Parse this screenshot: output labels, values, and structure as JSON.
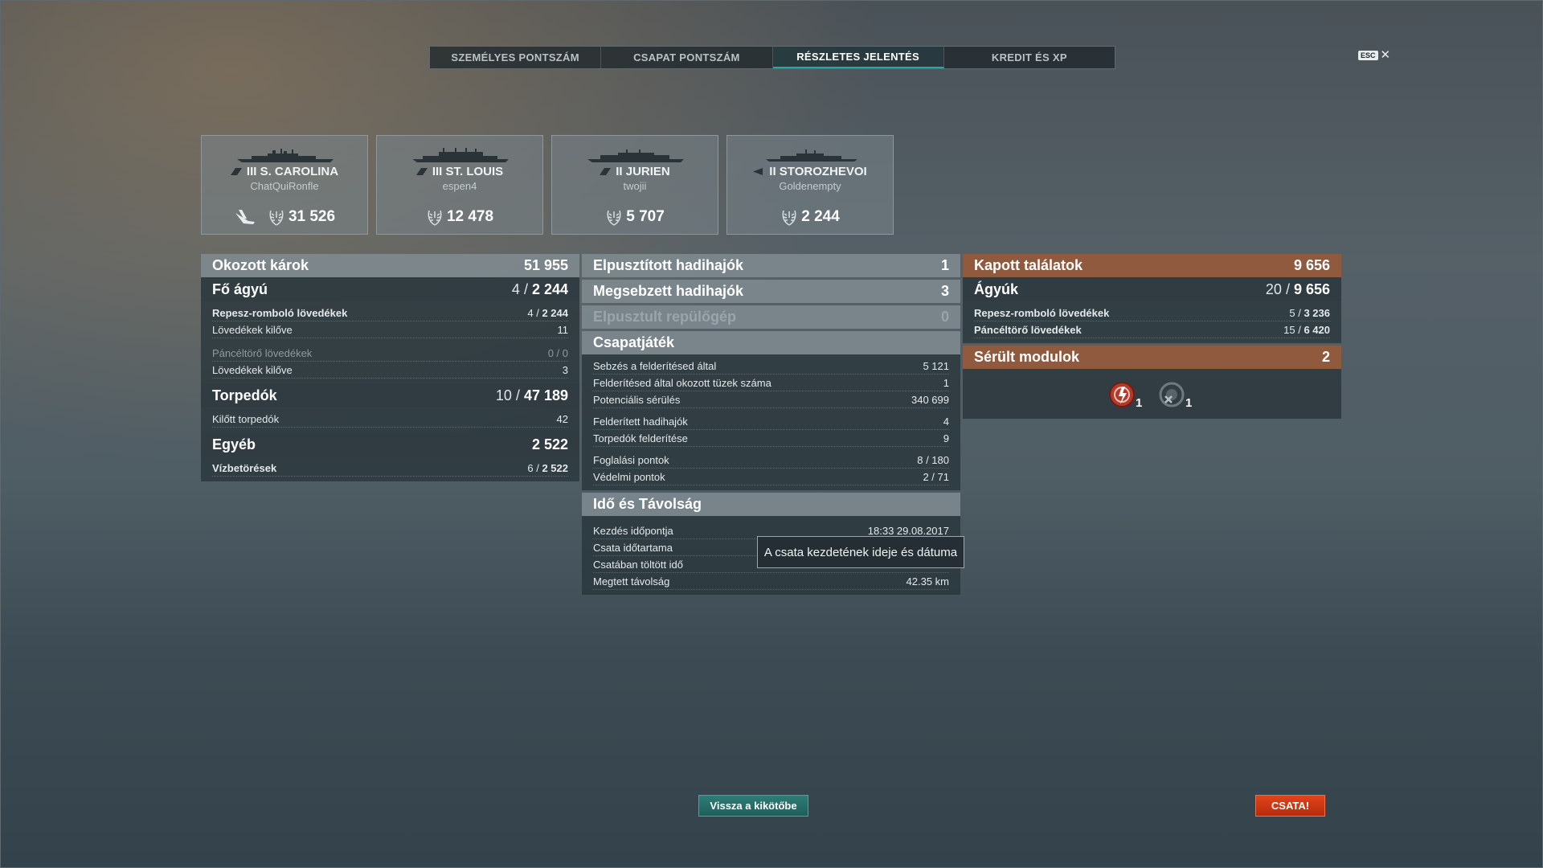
{
  "tabs": [
    {
      "label": "SZEMÉLYES PONTSZÁM"
    },
    {
      "label": "CSAPAT PONTSZÁM"
    },
    {
      "label": "RÉSZLETES JELENTÉS"
    },
    {
      "label": "KREDIT ÉS XP"
    }
  ],
  "active_tab": "RÉSZLETES JELENTÉS",
  "esc": {
    "key": "ESC",
    "close": "✕"
  },
  "ships": [
    {
      "name": "III S. CAROLINA",
      "player": "ChatQuiRonfle",
      "score": "31 526",
      "class_icon": "cruiser-icon",
      "extra_icon": "plane-icon"
    },
    {
      "name": "III ST. LOUIS",
      "player": "espen4",
      "score": "12 478",
      "class_icon": "cruiser-icon"
    },
    {
      "name": "II JURIEN",
      "player": "twojii",
      "score": "5 707",
      "class_icon": "cruiser-icon"
    },
    {
      "name": "II STOROZHEVOI",
      "player": "Goldenempty",
      "score": "2 244",
      "class_icon": "destroyer-icon"
    }
  ],
  "damage": {
    "title": "Okozott károk",
    "total": "51 955",
    "main_battery": {
      "title": "Fő ágyú",
      "hits": "4",
      "value": "2 244"
    },
    "he_shells": {
      "label": "Repesz-romboló lövedékek",
      "hits": "4",
      "value": "2 244"
    },
    "he_fired": {
      "label": "Lövedékek kilőve",
      "value": "11"
    },
    "ap_shells": {
      "label": "Páncéltörő lövedékek",
      "value": "0 / 0"
    },
    "ap_fired": {
      "label": "Lövedékek kilőve",
      "value": "3"
    },
    "torpedoes": {
      "title": "Torpedók",
      "hits": "10",
      "value": "47 189"
    },
    "torp_fired": {
      "label": "Kilőtt torpedók",
      "value": "42"
    },
    "other": {
      "title": "Egyéb",
      "value": "2 522"
    },
    "flooding": {
      "label": "Vízbetörések",
      "hits": "6",
      "value": "2 522"
    }
  },
  "ships_destroyed": {
    "label": "Elpusztított hadihajók",
    "value": "1"
  },
  "ships_damaged": {
    "label": "Megsebzett hadihajók",
    "value": "3"
  },
  "planes_destroyed": {
    "label": "Elpusztult repülőgép",
    "value": "0"
  },
  "teamplay": {
    "title": "Csapatjáték",
    "rows": [
      {
        "label": "Sebzés a felderítésed által",
        "value": "5 121"
      },
      {
        "label": "Felderítésed által okozott tüzek száma",
        "value": "1"
      },
      {
        "label": "Potenciális sérülés",
        "value": "340 699"
      },
      {
        "label": "Felderített hadihajók",
        "value": "4"
      },
      {
        "label": "Torpedók felderítése",
        "value": "9"
      },
      {
        "label": "Foglalási pontok",
        "value": "8 / 180"
      },
      {
        "label": "Védelmi pontok",
        "value": "2 / 71"
      }
    ]
  },
  "time": {
    "title": "Idő és Távolság",
    "rows": [
      {
        "label": "Kezdés időpontja",
        "value": "18:33  29.08.2017"
      },
      {
        "label": "Csata időtartama",
        "value": ""
      },
      {
        "label": "Csatában töltött idő",
        "value": ""
      },
      {
        "label": "Megtett távolság",
        "value": "42.35 km"
      }
    ]
  },
  "tooltip": "A csata kezdetének ideje és dátuma",
  "received": {
    "title": "Kapott találatok",
    "total": "9 656",
    "guns": {
      "title": "Ágyúk",
      "hits": "20",
      "value": "9 656"
    },
    "he": {
      "label": "Repesz-romboló lövedékek",
      "hits": "5",
      "value": "3 236"
    },
    "ap": {
      "label": "Páncéltörő lövedékek",
      "hits": "15",
      "value": "6 420"
    }
  },
  "modules": {
    "title": "Sérült modulok",
    "total": "2",
    "items": [
      {
        "icon": "damaged-engine-icon",
        "count": "1",
        "color": "#c0392b"
      },
      {
        "icon": "destroyed-module-icon",
        "count": "1",
        "color": "#7f8c8d"
      }
    ]
  },
  "buttons": {
    "back_to_port": "Vissza a kikötőbe",
    "battle": "CSATA!"
  },
  "colors": {
    "accent": "#26a8a4",
    "battle": "#d9381a",
    "received_header": "#965a3c"
  }
}
